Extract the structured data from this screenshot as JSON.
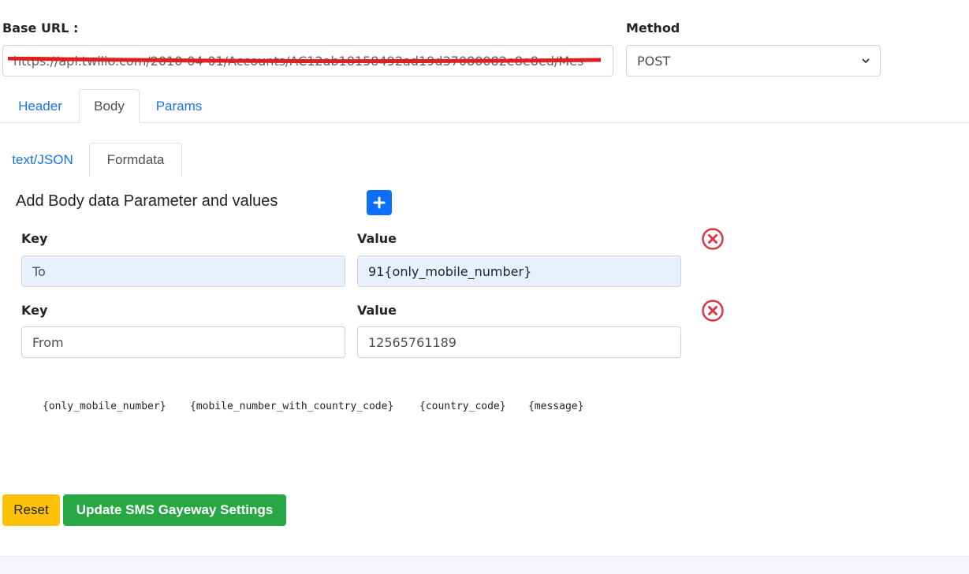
{
  "base_url": {
    "label": "Base URL :",
    "value": "https://api.twilio.com/2010-04-01/Accounts/AC12ab18158492ad19d37080082e8e8ed/Mes"
  },
  "method": {
    "label": "Method",
    "selected": "POST"
  },
  "tabs": [
    {
      "label": "Header"
    },
    {
      "label": "Body"
    },
    {
      "label": "Params"
    }
  ],
  "subtabs": [
    {
      "label": "text/JSON"
    },
    {
      "label": "Formdata"
    }
  ],
  "body_section": {
    "title": "Add Body data Parameter and values",
    "add_icon": "plus-icon"
  },
  "params": [
    {
      "key_label": "Key",
      "value_label": "Value",
      "key": "To",
      "value": "91{only_mobile_number}"
    },
    {
      "key_label": "Key",
      "value_label": "Value",
      "key": "From",
      "value": "12565761189"
    }
  ],
  "placeholders": [
    "{only_mobile_number}",
    "{mobile_number_with_country_code}",
    "{country_code}",
    "{message}"
  ],
  "buttons": {
    "reset": "Reset",
    "update": "Update SMS Gayeway Settings"
  },
  "colors": {
    "primary": "#0d6efd",
    "link": "#1a73e8",
    "warning": "#ffc107",
    "success": "#28a745",
    "danger": "#dc3545"
  }
}
